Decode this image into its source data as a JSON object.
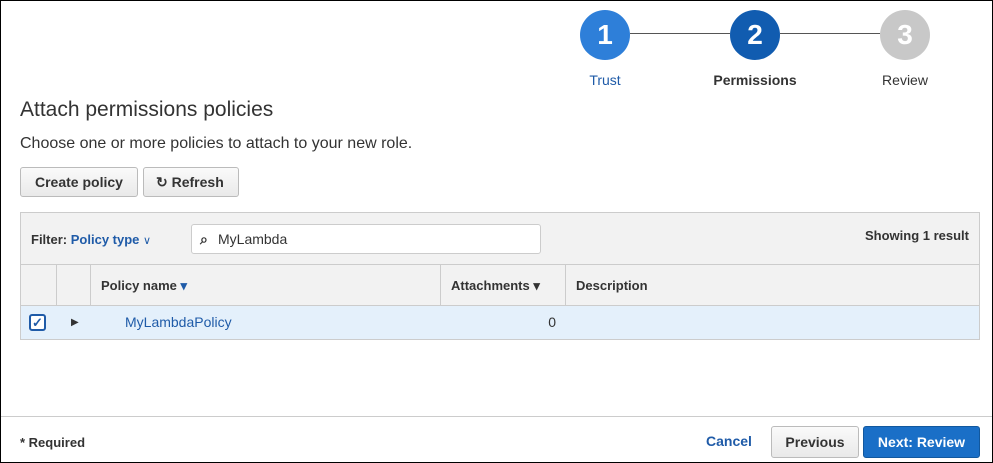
{
  "steps": [
    {
      "num": "1",
      "label": "Trust",
      "color": "#2e7fd9"
    },
    {
      "num": "2",
      "label": "Permissions",
      "color": "#115cb0"
    },
    {
      "num": "3",
      "label": "Review",
      "color": "#c8c8c8"
    }
  ],
  "title": "Attach permissions policies",
  "subtitle": "Choose one or more policies to attach to your new role.",
  "toolbar": {
    "create": "Create policy",
    "refresh": "Refresh"
  },
  "filter": {
    "label": "Filter:",
    "value": "Policy type",
    "search_value": "MyLambda",
    "result": "Showing 1 result"
  },
  "columns": [
    "Policy name",
    "Attachments",
    "Description"
  ],
  "rows": [
    {
      "name": "MyLambdaPolicy",
      "attachments": "0",
      "description": "",
      "checked": true
    }
  ],
  "footer": {
    "required": "* Required",
    "cancel": "Cancel",
    "previous": "Previous",
    "next": "Next: Review"
  }
}
